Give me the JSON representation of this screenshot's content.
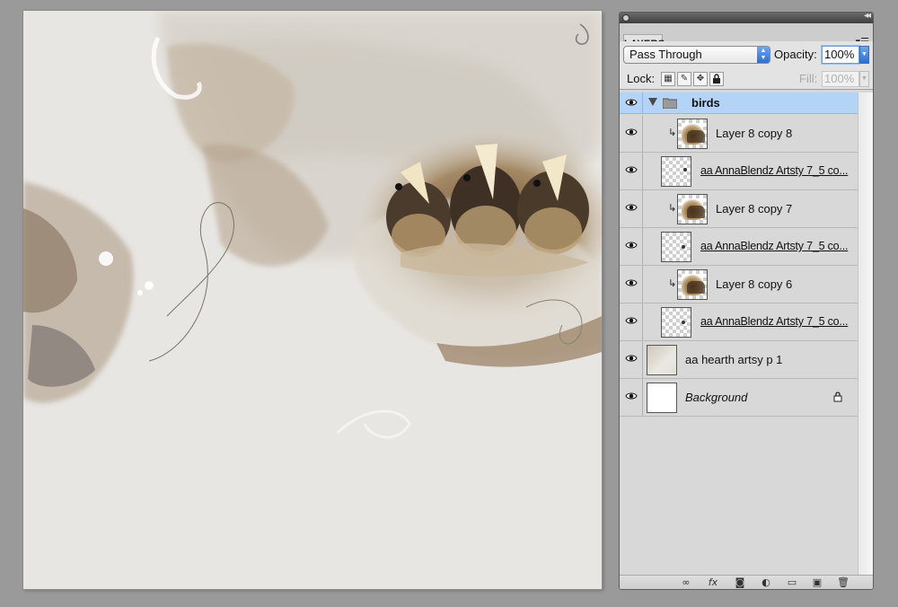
{
  "panel": {
    "tab_label": "LAYERS",
    "menu_icon": "panel-menu-icon",
    "blend_mode": "Pass Through",
    "opacity_label": "Opacity:",
    "opacity_value": "100%",
    "lock_label": "Lock:",
    "fill_label": "Fill:",
    "fill_value": "100%"
  },
  "layers": [
    {
      "name": "birds",
      "kind": "group",
      "selected": true
    },
    {
      "name": "Layer 8 copy 8",
      "kind": "clipped-image"
    },
    {
      "name": "aa AnnaBlendz Artsty 7_5 co...",
      "kind": "mask"
    },
    {
      "name": "Layer 8 copy 7",
      "kind": "clipped-image"
    },
    {
      "name": "aa AnnaBlendz Artsty 7_5 co...",
      "kind": "mask"
    },
    {
      "name": "Layer 8 copy 6",
      "kind": "clipped-image"
    },
    {
      "name": "aa AnnaBlendz Artsty 7_5 co...",
      "kind": "mask"
    },
    {
      "name": "aa hearth artsy p 1",
      "kind": "paper"
    },
    {
      "name": "Background",
      "kind": "background",
      "locked": true
    }
  ],
  "bottom_icons": [
    "link-layers-icon",
    "fx-icon",
    "add-mask-icon",
    "adjustment-layer-icon",
    "new-group-icon",
    "new-layer-icon",
    "trash-icon"
  ],
  "colors": {
    "selection": "#b4d4f7",
    "accent": "#2b6fd6"
  }
}
